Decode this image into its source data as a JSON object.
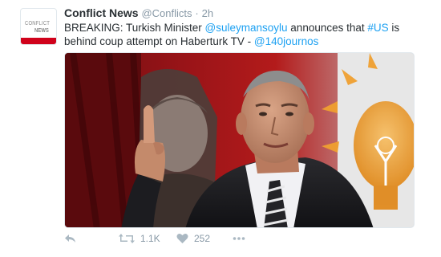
{
  "avatar": {
    "line1": "CONFLICT",
    "line2": "NEWS",
    "brand_color": "#d0021b"
  },
  "tweet": {
    "name": "Conflict News",
    "handle": "@Conflicts",
    "separator": "·",
    "time": "2h",
    "text_parts": {
      "p1": "BREAKING: Turkish Minister ",
      "mention1": "@suleymansoylu",
      "p2": " announces that ",
      "hashtag": "#US",
      "p3": " is behind coup attempt on Haberturk TV - ",
      "mention2": "@140journos"
    },
    "link_color": "#1da1f2"
  },
  "actions": {
    "reply_icon": "reply-icon",
    "retweet_icon": "retweet-icon",
    "retweet_count": "1.1K",
    "like_icon": "heart-icon",
    "like_count": "252",
    "more_icon": "more-icon"
  }
}
